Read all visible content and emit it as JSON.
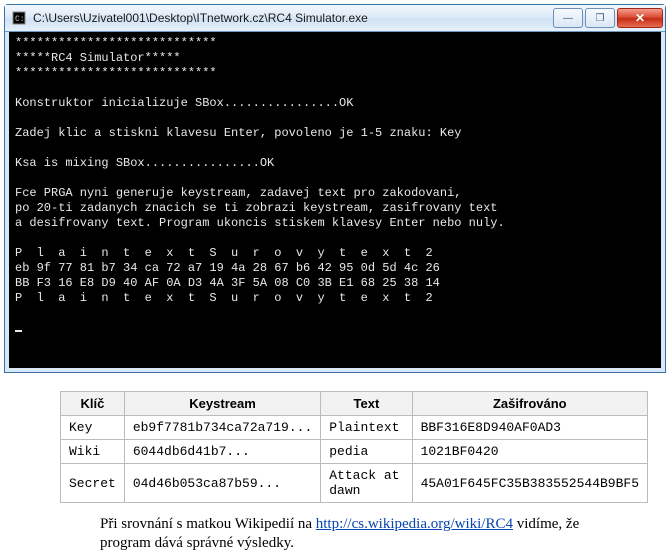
{
  "window": {
    "title": "C:\\Users\\Uzivatel001\\Desktop\\ITnetwork.cz\\RC4 Simulator.exe",
    "buttons": {
      "min": "—",
      "max": "❐",
      "close": "✕"
    }
  },
  "console": {
    "lines": [
      "****************************",
      "*****RC4 Simulator*****",
      "****************************",
      "",
      "Konstruktor inicializuje SBox................OK",
      "",
      "Zadej klic a stiskni klavesu Enter, povoleno je 1-5 znaku: Key",
      "",
      "Ksa is mixing SBox................OK",
      "",
      "Fce PRGA nyni generuje keystream, zadavej text pro zakodovani,",
      "po 20-ti zadanych znacich se ti zobrazi keystream, zasifrovany text",
      "a desifrovany text. Program ukoncis stiskem klavesy Enter nebo nuly.",
      "",
      "P  l  a  i  n  t  e  x  t  S  u  r  o  v  y  t  e  x  t  2",
      "eb 9f 77 81 b7 34 ca 72 a7 19 4a 28 67 b6 42 95 0d 5d 4c 26",
      "BB F3 16 E8 D9 40 AF 0A D3 4A 3F 5A 08 C0 3B E1 68 25 38 14",
      "P  l  a  i  n  t  e  x  t  S  u  r  o  v  y  t  e  x  t  2",
      ""
    ]
  },
  "table": {
    "headers": [
      "Klíč",
      "Keystream",
      "Text",
      "Zašifrováno"
    ],
    "rows": [
      [
        "Key",
        "eb9f7781b734ca72a719...",
        "Plaintext",
        "BBF316E8D940AF0AD3"
      ],
      [
        "Wiki",
        "6044db6d41b7...",
        "pedia",
        "1021BF0420"
      ],
      [
        "Secret",
        "04d46b053ca87b59...",
        "Attack at dawn",
        "45A01F645FC35B383552544B9BF5"
      ]
    ]
  },
  "caption": {
    "pre": "Při srovnání s matkou Wikipedií na ",
    "link_text": "http://cs.wikipedia.org/wiki/RC4",
    "post": " vidíme, že program dává správné výsledky."
  }
}
